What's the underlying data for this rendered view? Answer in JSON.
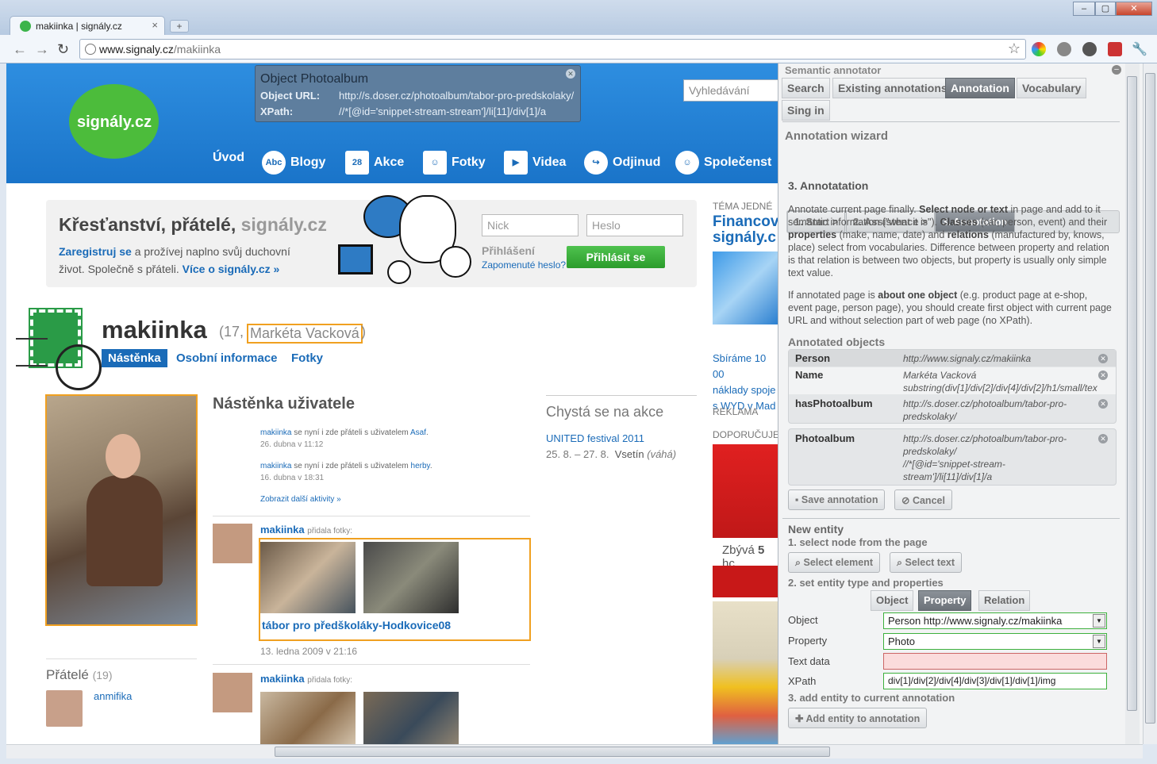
{
  "browser": {
    "tab_title": "makiinka | signály.cz",
    "tab_close": "×",
    "new_tab": "+",
    "url_domain": "www.signaly.cz",
    "url_path": "/makiinka",
    "min": "–",
    "max": "▢",
    "close": "✕"
  },
  "site": {
    "logo": "signály.cz",
    "search_placeholder": "Vyhledávání",
    "nav": [
      {
        "label": "Úvod",
        "icon": ""
      },
      {
        "label": "Blogy",
        "icon": "Abc"
      },
      {
        "label": "Akce",
        "icon": "28"
      },
      {
        "label": "Fotky",
        "icon": "☺"
      },
      {
        "label": "Videa",
        "icon": "▶"
      },
      {
        "label": "Odjinud",
        "icon": "↪"
      },
      {
        "label": "Společenst",
        "icon": "☺"
      }
    ],
    "tooltip": {
      "title": "Object Photoalbum",
      "url_label": "Object URL:",
      "url_value": "http://s.doser.cz/photoalbum/tabor-pro-predskolaky/",
      "xpath_label": "XPath:",
      "xpath_value": "//*[@id='snippet-stream-stream']/li[11]/div[1]/a"
    },
    "banner": {
      "title_main": "Křesťanství, přátelé,",
      "title_site": " signály.cz",
      "register": "Zaregistruj se",
      "text1": " a prožívej naplno svůj duchovní život. Společně s přáteli. ",
      "more": "Více o signály.cz »",
      "nick_placeholder": "Nick",
      "pass_placeholder": "Heslo",
      "login_label": "Přihlášení",
      "forgot": "Zapomenuté heslo?",
      "login_button": "Přihlásit se"
    },
    "profile": {
      "username": "makiinka",
      "age": "(17,",
      "realname": "Markéta Vacková",
      "realname_close": ")",
      "tabs": [
        "Nástěnka",
        "Osobní informace",
        "Fotky"
      ],
      "friends_title": "Přátelé",
      "friends_count": "(19)",
      "friend_name": "anmifika"
    },
    "wall": {
      "title": "Nástěnka uživatele",
      "activities": [
        {
          "user": "makiinka",
          "text": " se nyní i zde přáteli s uživatelem ",
          "other": "Asaf",
          "end": ".",
          "date": "26. dubna v 11:12"
        },
        {
          "user": "makiinka",
          "text": " se nyní i zde přáteli s uživatelem ",
          "other": "herby",
          "end": ".",
          "date": "16. dubna v 18:31"
        }
      ],
      "more": "Zobrazit další aktivity »",
      "post1_user": "makiinka",
      "post1_action": "přidala fotky:",
      "post1_title": "tábor pro předškoláky-Hodkovice08",
      "post1_date": "13. ledna 2009 v 21:16",
      "post2_user": "makiinka",
      "post2_action": "přidala fotky:"
    },
    "events": {
      "title": "Chystá se na akce",
      "name": "UNITED festival 2011",
      "date": "25. 8. – 27. 8.",
      "place": "Vsetín",
      "region": "(váhá)"
    },
    "right": {
      "theme": "TÉMA JEDNÉ",
      "theme_title1": "Financov",
      "theme_title2": "signály.c",
      "collect1": "Sbíráme 10 00",
      "collect2": "náklady spoje",
      "collect3": "s WYD v Mad",
      "ad": "REKLAMA",
      "recommend": "DOPORUČUJE",
      "remain": "Zbývá",
      "remain_num": "5",
      "remain_rest": " hc"
    }
  },
  "panel": {
    "title": "Semantic annotator",
    "tabs": [
      "Search",
      "Existing annotations",
      "Annotation",
      "Vocabulary",
      "Sing in"
    ],
    "wizard_title": "Annotation wizard",
    "wizard_steps": [
      "1. Start >",
      "2. Assistence >",
      "3. Annotation"
    ],
    "step_title": "3. Annotatation",
    "para1_a": "Annotate current page finally. ",
    "para1_b": "Select node or text",
    "para1_c": " in page and add to it semantic information (\"what it is\"). ",
    "para1_d": "Classes",
    "para1_e": " (car, person, event) and their ",
    "para1_f": "properties",
    "para1_g": " (make, name, date) and ",
    "para1_h": "relations",
    "para1_i": " (manufactured by, knows, place) select from vocabularies. Difference between property and relation is that relation is between two objects, but property is usually only simple text value.",
    "para2_a": "If annotated page is ",
    "para2_b": "about one object",
    "para2_c": " (e.g. product page at e-shop, event page, person page), you should create first object with current page URL and without selection part of web page (no XPath).",
    "annotated_title": "Annotated objects",
    "objects1": [
      {
        "k": "Person",
        "v": "http://www.signaly.cz/makiinka"
      },
      {
        "k": "Name",
        "v": "Markéta Vacková",
        "v2": "substring(div[1]/div[2]/div[4]/div[2]/h1/small/tex"
      },
      {
        "k": "hasPhotoalbum",
        "v": "http://s.doser.cz/photoalbum/tabor-pro-",
        "v2": "predskolaky/"
      }
    ],
    "object2": {
      "k": "Photoalbum",
      "v": "http://s.doser.cz/photoalbum/tabor-pro-",
      "v2": "predskolaky/",
      "v3": "//*[@id='snippet-stream-",
      "v4": "stream']/li[11]/div[1]/a"
    },
    "save": "Save annotation",
    "cancel": "Cancel",
    "new_entity": "New entity",
    "step1": "1. select node from the page",
    "select_element": "Select element",
    "select_text": "Select text",
    "step2": "2. set entity type and properties",
    "type_tabs": [
      "Object",
      "Property",
      "Relation"
    ],
    "f_object_label": "Object",
    "f_object_value": "Person http://www.signaly.cz/makiinka",
    "f_property_label": "Property",
    "f_property_value": "Photo",
    "f_text_label": "Text data",
    "f_text_value": "",
    "f_xpath_label": "XPath",
    "f_xpath_value": "div[1]/div[2]/div[4]/div[3]/div[1]/div[1]/img",
    "step3": "3. add entity to current annotation",
    "add_entity": "Add entity to annotation"
  },
  "colors": {
    "accent": "#1a6bb8",
    "green": "#4cbc3b",
    "highlight": "#f0a020"
  }
}
